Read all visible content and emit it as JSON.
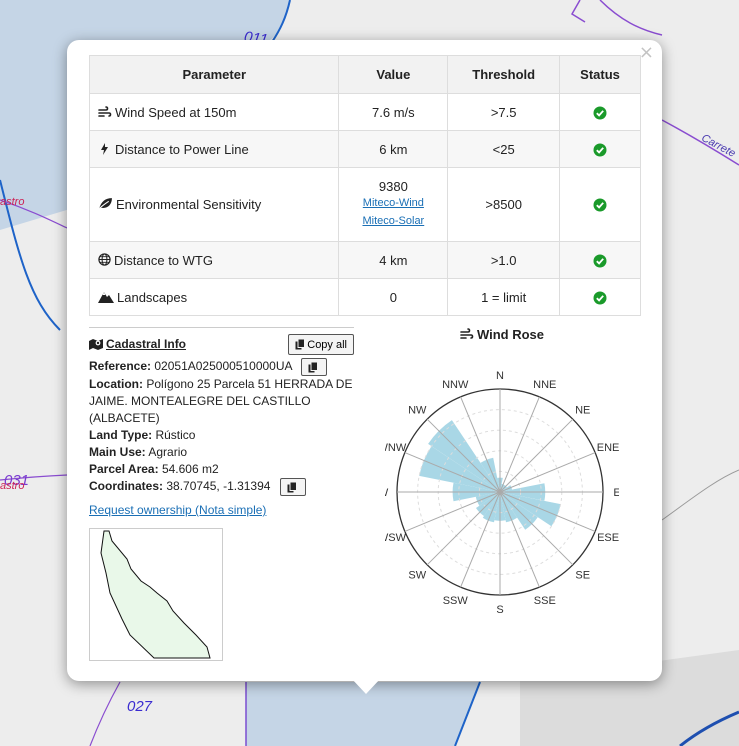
{
  "map": {
    "labels": [
      {
        "text": "011",
        "color": "#3a2bd0"
      },
      {
        "text": "astro",
        "color": "#cc2255"
      },
      {
        "text": "031",
        "color": "#7a3bd0"
      },
      {
        "text": "astro",
        "color": "#cc2255"
      },
      {
        "text": "027",
        "color": "#3a2bd0"
      },
      {
        "text": "Carrete",
        "color": "#4a3bb0"
      }
    ]
  },
  "popup": {
    "close_label": "×",
    "table": {
      "headers": [
        "Parameter",
        "Value",
        "Threshold",
        "Status"
      ],
      "rows": [
        {
          "icon": "wind-icon",
          "parameter": "Wind Speed at 150m",
          "value": "7.6 m/s",
          "threshold": ">7.5",
          "status": "ok"
        },
        {
          "icon": "bolt-icon",
          "parameter": "Distance to Power Line",
          "value": "6 km",
          "threshold": "<25",
          "status": "ok"
        },
        {
          "icon": "leaf-icon",
          "parameter": "Environmental Sensitivity",
          "value": "9380",
          "links": [
            "Miteco-Wind",
            "Miteco-Solar"
          ],
          "threshold": ">8500",
          "status": "ok"
        },
        {
          "icon": "globe-icon",
          "parameter": "Distance to WTG",
          "value": "4 km",
          "threshold": ">1.0",
          "status": "ok"
        },
        {
          "icon": "mountain-icon",
          "parameter": "Landscapes",
          "value": "0",
          "threshold": "1 = limit",
          "status": "ok"
        }
      ],
      "status_color": "#1a9a2a"
    },
    "cadastral": {
      "title": "Cadastral Info",
      "copy_all_label": "Copy all",
      "reference_label": "Reference:",
      "reference_value": "02051A025000510000UA",
      "location_label": "Location:",
      "location_value": "Polígono 25 Parcela 51 HERRADA DE JAIME. MONTEALEGRE DEL CASTILLO (ALBACETE)",
      "land_type_label": "Land Type:",
      "land_type_value": "Rústico",
      "main_use_label": "Main Use:",
      "main_use_value": "Agrario",
      "parcel_area_label": "Parcel Area:",
      "parcel_area_value": "54.606 m2",
      "coordinates_label": "Coordinates:",
      "coordinates_value": "38.70745, -1.31394",
      "ownership_link": "Request ownership (Nota simple)"
    },
    "wind_rose": {
      "title": "Wind Rose",
      "directions": [
        "N",
        "NNE",
        "NE",
        "ENE",
        "E",
        "ESE",
        "SE",
        "SSE",
        "S",
        "SSW",
        "SW",
        "WSW",
        "W",
        "WNW",
        "NW",
        "NNW"
      ],
      "values": [
        0.14,
        0.08,
        0.08,
        0.12,
        0.44,
        0.6,
        0.44,
        0.3,
        0.28,
        0.3,
        0.28,
        0.24,
        0.46,
        0.8,
        0.84,
        0.34
      ],
      "max": 1.0,
      "fill_color": "#a9d7e6"
    }
  }
}
